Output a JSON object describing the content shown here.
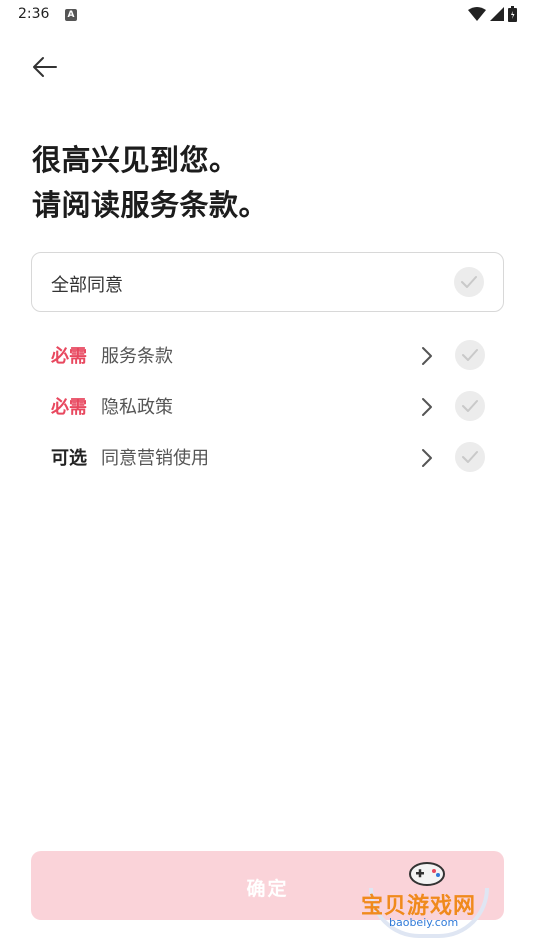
{
  "status_bar": {
    "time": "2:36",
    "notification_glyph": "A",
    "icons": [
      "wifi-icon",
      "signal-icon",
      "battery-icon"
    ]
  },
  "header": {
    "back_icon": "arrow-left-icon"
  },
  "headline": {
    "line1": "很高兴见到您。",
    "line2": "请阅读服务条款。"
  },
  "agree_all": {
    "label": "全部同意"
  },
  "terms": [
    {
      "tag": "必需",
      "text": "服务条款",
      "kind": "required"
    },
    {
      "tag": "必需",
      "text": "隐私政策",
      "kind": "required"
    },
    {
      "tag": "可选",
      "text": "同意营销使用",
      "kind": "optional"
    }
  ],
  "confirm": {
    "label": "确定"
  },
  "watermark": {
    "title": "宝贝游戏网",
    "url": "baobeiy.com"
  },
  "colors": {
    "required": "#e8485f",
    "confirm_disabled": "#fad3d9",
    "check_bg": "#ececec"
  }
}
